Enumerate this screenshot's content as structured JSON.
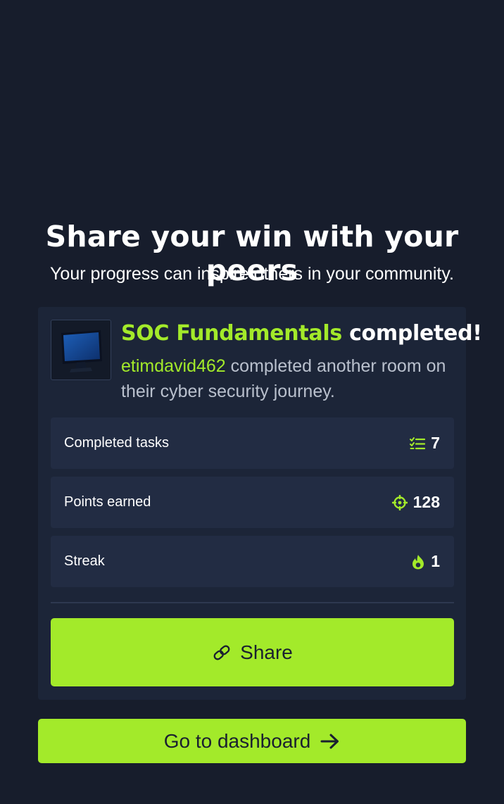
{
  "header": {
    "title": "Share your win with your peers",
    "subtitle": "Your progress can inspire others in your community."
  },
  "card": {
    "room_thumbnail_icon": "computer-monitor-icon",
    "room_name": "SOC Fundamentals",
    "completed_word": "completed!",
    "username": "etimdavid462",
    "description": "completed another room on their cyber security journey.",
    "stats": [
      {
        "label": "Completed tasks",
        "value": "7",
        "icon": "task-list-icon"
      },
      {
        "label": "Points earned",
        "value": "128",
        "icon": "crosshair-icon"
      },
      {
        "label": "Streak",
        "value": "1",
        "icon": "flame-icon"
      }
    ],
    "share_label": "Share",
    "share_icon": "link-icon"
  },
  "footer": {
    "dashboard_label": "Go to dashboard",
    "dashboard_icon": "arrow-right-icon"
  },
  "colors": {
    "background": "#171d2c",
    "card": "#1c2538",
    "stat_row": "#222c43",
    "accent": "#a3ea2a"
  }
}
